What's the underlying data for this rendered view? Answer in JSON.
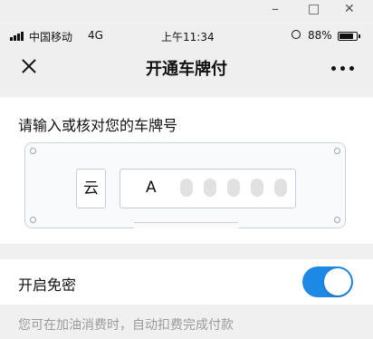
{
  "window_controls": {
    "minimize": "–",
    "maximize": "□",
    "close": "✕"
  },
  "status_bar": {
    "carrier": "中国移动",
    "network": "4G",
    "time": "上午11:34",
    "battery_percent": "88%",
    "battery_level": 0.88,
    "signal_bars": 4
  },
  "nav": {
    "title": "开通车牌付",
    "close_icon": "close-icon",
    "more_icon": "more-icon"
  },
  "plate_section": {
    "label": "请输入或核对您的车牌号",
    "province": "云",
    "number_visible": "A"
  },
  "auto_pay": {
    "label": "开启免密",
    "enabled": true,
    "hint": "您可在加油消费时，自动扣费完成付款"
  },
  "colors": {
    "accent": "#1e88e5",
    "background": "#f0f0f0",
    "card": "#ffffff"
  }
}
